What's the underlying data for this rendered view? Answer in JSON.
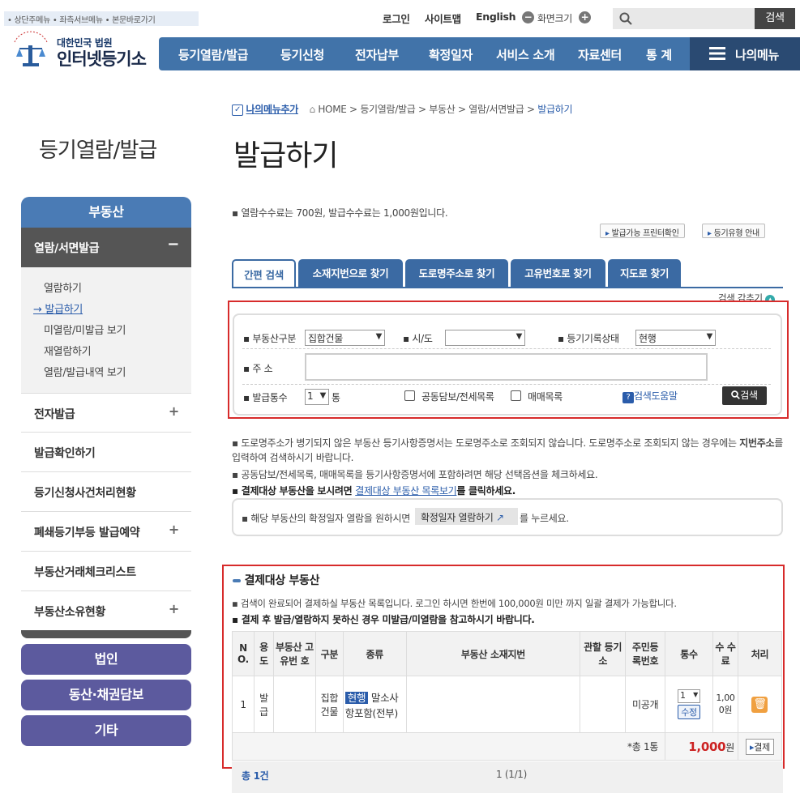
{
  "skip_links": "• 상단주메뉴 • 좌측서브메뉴 • 본문바로가기",
  "top": {
    "login": "로그인",
    "sitemap": "사이트맵",
    "english": "English",
    "zoom": "화면크기",
    "search_btn": "검색"
  },
  "logo": {
    "org": "대한민국 법원",
    "name": "인터넷등기소"
  },
  "nav": [
    "등기열람/발급",
    "등기신청",
    "전자납부",
    "확정일자",
    "서비스 소개",
    "자료센터",
    "통 계"
  ],
  "my_menu": "나의메뉴",
  "side": {
    "title": "등기열람/발급",
    "head": "부동산",
    "sub": "열람/서면발급",
    "sub_toggle": "−",
    "list": [
      "열람하기",
      "→ 발급하기",
      "미열람/미발급 보기",
      "재열람하기",
      "열람/발급내역 보기"
    ],
    "items": [
      {
        "label": "전자발급",
        "plus": "+"
      },
      {
        "label": "발급확인하기",
        "plus": ""
      },
      {
        "label": "등기신청사건처리현황",
        "plus": ""
      },
      {
        "label": "폐쇄등기부등 발급예약",
        "plus": "+"
      },
      {
        "label": "부동산거래체크리스트",
        "plus": ""
      },
      {
        "label": "부동산소유현황",
        "plus": "+"
      }
    ],
    "buttons": [
      "법인",
      "동산·채권담보",
      "기타"
    ]
  },
  "breadcrumb": {
    "add": "나의메뉴추가",
    "path": "HOME > 등기열람/발급 > 부동산 > 열람/서면발급 > ",
    "current": "발급하기"
  },
  "page_title": "발급하기",
  "fee_note": "열람수수료는 700원, 발급수수료는 1,000원입니다.",
  "printer_btn": "발급가능 프린터확인",
  "type_btn": "등기유형 안내",
  "tabs": [
    "간편 검색",
    "소재지번으로 찾기",
    "도로명주소로 찾기",
    "고유번호로 찾기",
    "지도로 찾기"
  ],
  "hide_search": "검색 감추기",
  "form": {
    "type_label": "부동산구분",
    "type_value": "집합건물",
    "city_label": "시/도",
    "city_value": "",
    "status_label": "등기기록상태",
    "status_value": "현행",
    "addr_label": "주 소",
    "addr_value": "",
    "count_label": "발급통수",
    "count_value": "1",
    "count_unit": "통",
    "chk1": "공동담보/전세목록",
    "chk2": "매매목록",
    "help": "검색도움말",
    "search": "검색"
  },
  "notes": [
    "도로명주소가 병기되지 않은 부동산 등기사항증명서는 도로명주소로 조회되지 않습니다. 도로명주소로 조회되지 않는 경우에는",
    "지번주소",
    "를 입력하여 검색하시기 바랍니다.",
    "공동담보/전세목록, 매매목록을 등기사항증명서에 포함하려면 해당 선택옵션을 체크하세요.",
    "결제대상 부동산을 보시려면",
    "결제대상 부동산 목록보기",
    "를 클릭하세요."
  ],
  "confirm_note": {
    "pre": "해당 부동산의 확정일자 열람을 원하시면",
    "btn": "확정일자 열람하기",
    "post": "를 누르세요."
  },
  "result": {
    "title": "결제대상 부동산",
    "note1": "검색이 완료되어 결제하실 부동산 목록입니다. 로그인 하시면 한번에 100,000원 미만 까지 일괄 결제가 가능합니다.",
    "note2": "결제 후 발급/열람하지 못하신 경우 미발급/미열람을 참고하시기 바랍니다.",
    "headers": [
      "N O.",
      "용 도",
      "부동산 고유번 호",
      "구분",
      "종류",
      "부동산 소재지번",
      "관할 등기소",
      "주민등 록번호",
      "통수",
      "수 수 료",
      "처리"
    ],
    "row": {
      "no": "1",
      "use": "발 급",
      "id": "",
      "div": "집합 건물",
      "status": "현행",
      "kind": "말소사항포함(전부)",
      "addr": "",
      "office": "",
      "rrn": "미공개",
      "count": "1",
      "edit": "수정",
      "fee": "1,00 0원"
    },
    "total_label": "*총 1통",
    "total_fee": "1,000",
    "won": "원",
    "pay": "결제"
  },
  "footer": {
    "total": "총 1건",
    "page": "1 (1/1)"
  }
}
